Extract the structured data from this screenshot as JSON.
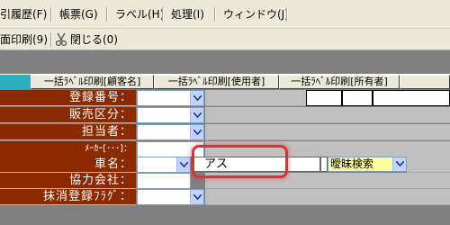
{
  "menu": {
    "items": [
      {
        "label": "引履歴(F)"
      },
      {
        "label": "帳票(G)"
      },
      {
        "label": "ラベル(H)"
      },
      {
        "label": "処理(I)"
      },
      {
        "label": "ウィンドウ(J)"
      }
    ]
  },
  "toolbar": {
    "print_label": "面印刷(9)",
    "close_label": "閉じる(0)"
  },
  "tabs": [
    {
      "label": "一括ﾗﾍﾞﾙ印刷[顧客名]"
    },
    {
      "label": "一括ﾗﾍﾞﾙ印刷[使用者]"
    },
    {
      "label": "一括ﾗﾍﾞﾙ印刷[所有者]"
    }
  ],
  "form": {
    "fields": [
      {
        "label": "登録番号："
      },
      {
        "label": "販売区分："
      },
      {
        "label": "担当者："
      },
      {
        "label": "ﾒｰｶｰ[･･･]："
      },
      {
        "label": "車名："
      },
      {
        "label": "協力会社："
      },
      {
        "label": "抹消登録ﾌﾗｸﾞ："
      }
    ],
    "vehicle_name_value": "アス",
    "search_mode": "曖昧検索"
  },
  "colors": {
    "label_bg": "#8b2a00",
    "accent_tab": "#2ab0c0",
    "highlight": "#e03030",
    "fuzzy_bg": "#ffffa0"
  }
}
